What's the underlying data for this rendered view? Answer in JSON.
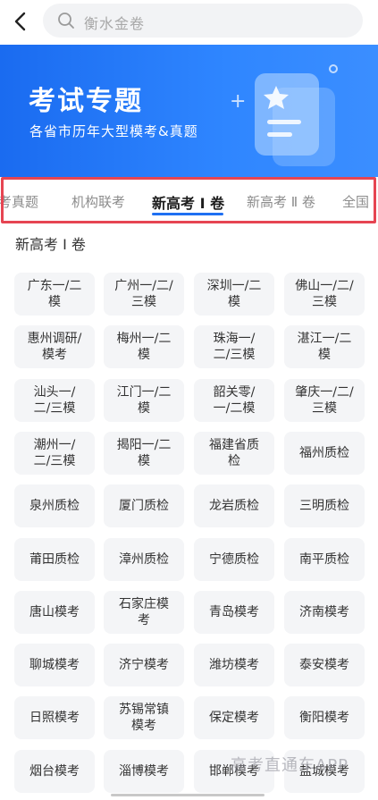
{
  "search": {
    "placeholder": "衡水金卷"
  },
  "banner": {
    "title": "考试专题",
    "subtitle": "各省市历年大型模考&真题"
  },
  "tabs": [
    {
      "label": "高考真题",
      "visible_label": "考真题",
      "active": false
    },
    {
      "label": "机构联考",
      "active": false
    },
    {
      "label": "新高考Ⅰ卷",
      "visible_label": "新高考 Ⅰ 卷",
      "active": true
    },
    {
      "label": "新高考Ⅱ卷",
      "visible_label": "新高考 Ⅱ 卷",
      "active": false
    },
    {
      "label": "全国",
      "active": false
    }
  ],
  "section_title": "新高考Ⅰ卷",
  "section_title_visible": "新高考 Ⅰ 卷",
  "grid_items": [
    "广东一/二模",
    "广州一/二/三模",
    "深圳一/二模",
    "佛山一/二/三模",
    "惠州调研/模考",
    "梅州一/二模",
    "珠海一/二/三模",
    "湛江一/二模",
    "汕头一/二/三模",
    "江门一/二模",
    "韶关零/一/二模",
    "肇庆一/二/三模",
    "潮州一/二/三模",
    "揭阳一/二模",
    "福建省质检",
    "福州质检",
    "泉州质检",
    "厦门质检",
    "龙岩质检",
    "三明质检",
    "莆田质检",
    "漳州质检",
    "宁德质检",
    "南平质检",
    "唐山模考",
    "石家庄模考",
    "青岛模考",
    "济南模考",
    "聊城模考",
    "济宁模考",
    "潍坊模考",
    "泰安模考",
    "日照模考",
    "苏锡常镇模考",
    "保定模考",
    "衡阳模考",
    "烟台模考",
    "淄博模考",
    "邯郸模考",
    "盐城模考"
  ],
  "grid_lines": [
    [
      "广东一/二",
      "模"
    ],
    [
      "广州一/二/",
      "三模"
    ],
    [
      "深圳一/二",
      "模"
    ],
    [
      "佛山一/二/",
      "三模"
    ],
    [
      "惠州调研/",
      "模考"
    ],
    [
      "梅州一/二",
      "模"
    ],
    [
      "珠海一/",
      "二/三模"
    ],
    [
      "湛江一/二",
      "模"
    ],
    [
      "汕头一/",
      "二/三模"
    ],
    [
      "江门一/二",
      "模"
    ],
    [
      "韶关零/",
      "一/二模"
    ],
    [
      "肇庆一/二/",
      "三模"
    ],
    [
      "潮州一/",
      "二/三模"
    ],
    [
      "揭阳一/二",
      "模"
    ],
    [
      "福建省质",
      "检"
    ],
    [
      "福州质检"
    ],
    [
      "泉州质检"
    ],
    [
      "厦门质检"
    ],
    [
      "龙岩质检"
    ],
    [
      "三明质检"
    ],
    [
      "莆田质检"
    ],
    [
      "漳州质检"
    ],
    [
      "宁德质检"
    ],
    [
      "南平质检"
    ],
    [
      "唐山模考"
    ],
    [
      "石家庄模",
      "考"
    ],
    [
      "青岛模考"
    ],
    [
      "济南模考"
    ],
    [
      "聊城模考"
    ],
    [
      "济宁模考"
    ],
    [
      "潍坊模考"
    ],
    [
      "泰安模考"
    ],
    [
      "日照模考"
    ],
    [
      "苏锡常镇",
      "模考"
    ],
    [
      "保定模考"
    ],
    [
      "衡阳模考"
    ],
    [
      "烟台模考"
    ],
    [
      "淄博模考"
    ],
    [
      "邯郸模考"
    ],
    [
      "盐城模考"
    ]
  ],
  "watermark": "高考直通车APP",
  "colors": {
    "primary": "#1f6ff2",
    "highlight_border": "#e64552",
    "cell_bg": "#f4f5f7"
  },
  "icons": {
    "back": "chevron-left-icon",
    "search": "search-icon",
    "banner": "document-star-icon"
  }
}
